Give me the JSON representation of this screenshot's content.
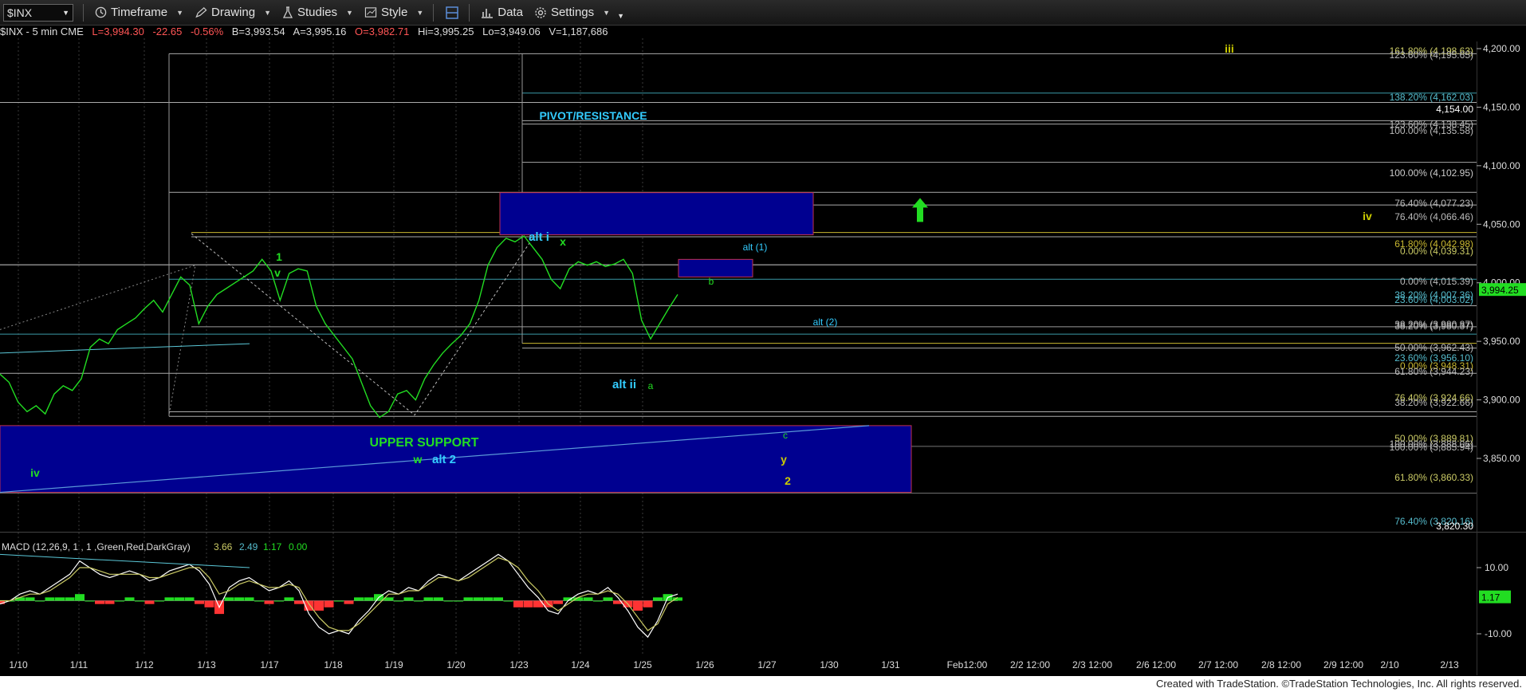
{
  "toolbar": {
    "symbol": "$INX",
    "items": [
      {
        "label": "Timeframe",
        "icon": "clock-icon"
      },
      {
        "label": "Drawing",
        "icon": "pencil-icon"
      },
      {
        "label": "Studies",
        "icon": "flask-icon"
      },
      {
        "label": "Style",
        "icon": "chart-style-icon"
      },
      {
        "label": "Data",
        "icon": "data-icon"
      },
      {
        "label": "Settings",
        "icon": "gear-icon"
      }
    ]
  },
  "info": {
    "symbol": "$INX - 5 min  CME",
    "last": "L=3,994.30",
    "change": "-22.65",
    "pct": "-0.56%",
    "bid": "B=3,993.54",
    "ask": "A=3,995.16",
    "open": "O=3,982.71",
    "high": "Hi=3,995.25",
    "low": "Lo=3,949.06",
    "volume": "V=1,187,686"
  },
  "colors": {
    "up": "#22dd22",
    "down": "#ff3333",
    "cyan": "#33ccff",
    "fib": "#cccc66",
    "box": "#000090"
  },
  "chart_data": [
    {
      "type": "line",
      "title": "$INX - 5 min",
      "x_ticks": [
        "1/10",
        "1/11",
        "1/12",
        "1/13",
        "1/17",
        "1/18",
        "1/19",
        "1/20",
        "1/23",
        "1/24",
        "1/25",
        "1/26",
        "1/27",
        "1/30",
        "1/31",
        "Feb12:00",
        "2/2 12:00",
        "2/3 12:00",
        "2/6 12:00",
        "2/7 12:00",
        "2/8 12:00",
        "2/9 12:00",
        "2/10",
        "2/13"
      ],
      "y_ticks": [
        "4,200.00",
        "4,150.00",
        "4,100.00",
        "4,050.00",
        "4,000.00",
        "3,950.00",
        "3,900.00",
        "3,850.00"
      ],
      "ylim": [
        3820,
        4225
      ],
      "last_price": "3,994.25",
      "series": [
        {
          "values": [
            3922,
            3915,
            3898,
            3890,
            3895,
            3888,
            3905,
            3912,
            3908,
            3918,
            3945,
            3952,
            3948,
            3960,
            3965,
            3970,
            3978,
            3985,
            3975,
            3990,
            4005,
            3998,
            3965,
            3980,
            3990,
            3995,
            4000,
            4005,
            4010,
            4020,
            4010,
            3985,
            4008,
            4012,
            4010,
            3980,
            3965,
            3955,
            3945,
            3935,
            3915,
            3895,
            3885,
            3890,
            3905,
            3908,
            3900,
            3918,
            3930,
            3940,
            3948,
            3955,
            3965,
            3985,
            4015,
            4030,
            4038,
            4035,
            4040,
            4030,
            4020,
            4003,
            3995,
            4012,
            4018,
            4015,
            4018,
            4014,
            4016,
            4020,
            4008,
            3968,
            3952,
            3965,
            3978,
            3990
          ]
        }
      ],
      "annotations": [
        {
          "text": "PIVOT/RESISTANCE"
        },
        {
          "text": "UPPER SUPPORT"
        },
        {
          "text": "iii"
        },
        {
          "text": "iv"
        },
        {
          "text": "iv"
        },
        {
          "text": "1"
        },
        {
          "text": "v"
        },
        {
          "text": "w"
        },
        {
          "text": "alt 2"
        },
        {
          "text": "alt i"
        },
        {
          "text": "x"
        },
        {
          "text": "alt ii"
        },
        {
          "text": "a"
        },
        {
          "text": "b"
        },
        {
          "text": "c"
        },
        {
          "text": "y"
        },
        {
          "text": "2"
        },
        {
          "text": "alt (1)"
        },
        {
          "text": "alt (2)"
        }
      ],
      "fib_labels": [
        {
          "text": "161.80% (4,198.63)"
        },
        {
          "text": "123.60% (4,195.65)"
        },
        {
          "text": "138.20% (4,162.03)"
        },
        {
          "text": "4,154.00"
        },
        {
          "text": "123.60% (4,138.45)"
        },
        {
          "text": "100.00% (4,135.58)"
        },
        {
          "text": "100.00% (4,102.95)"
        },
        {
          "text": "76.40% (4,077.23)"
        },
        {
          "text": "76.40% (4,066.46)"
        },
        {
          "text": "61.80% (4,042.98)"
        },
        {
          "text": "0.00% (4,039.31)"
        },
        {
          "text": "0.00% (4,015.39)"
        },
        {
          "text": "38.20% (4,007.36)"
        },
        {
          "text": "23.60% (4,003.02)"
        },
        {
          "text": "38.20% (3,980.87)"
        },
        {
          "text": "38.20% (3,980.37)"
        },
        {
          "text": "50.00% (3,962.43)"
        },
        {
          "text": "23.60% (3,956.10)"
        },
        {
          "text": "0.00% (3,948.31)"
        },
        {
          "text": "61.80% (3,944.23)"
        },
        {
          "text": "76.40% (3,924.66)"
        },
        {
          "text": "38.20% (3,922.66)"
        },
        {
          "text": "50.00% (3,889.81)"
        },
        {
          "text": "100.00% (3,888.06)"
        },
        {
          "text": "100.00% (3,885.94)"
        },
        {
          "text": "61.80% (3,860.33)"
        },
        {
          "text": "76.40% (3,820.16)"
        },
        {
          "text": "3,820.30"
        }
      ]
    },
    {
      "type": "line",
      "title": "MACD (12,26,9, 1 , 1 ,Green,Red,DarkGray)",
      "legend_values": [
        "3.66",
        "2.49",
        "1.17",
        "0.00"
      ],
      "y_ticks": [
        "10.00",
        "-10.00"
      ],
      "ylim": [
        -12,
        14
      ],
      "last_value": "1.17",
      "series": [
        {
          "name": "MACD",
          "values": [
            -1,
            0,
            2,
            3,
            2,
            4,
            6,
            8,
            12,
            10,
            8,
            7,
            8,
            9,
            8,
            6,
            7,
            9,
            10,
            11,
            9,
            5,
            -2,
            4,
            6,
            7,
            5,
            3,
            4,
            6,
            3,
            -4,
            -8,
            -10,
            -9,
            -10,
            -6,
            -3,
            1,
            3,
            2,
            4,
            3,
            6,
            8,
            7,
            6,
            8,
            10,
            12,
            14,
            12,
            8,
            4,
            1,
            -3,
            -4,
            0,
            2,
            3,
            2,
            4,
            1,
            -3,
            -8,
            -11,
            -6,
            1,
            2
          ]
        },
        {
          "name": "Signal",
          "values": [
            0,
            0,
            1,
            2,
            2,
            3,
            5,
            7,
            10,
            10,
            9,
            8,
            8,
            8,
            8,
            7,
            7,
            8,
            9,
            10,
            10,
            7,
            2,
            3,
            5,
            6,
            5,
            4,
            4,
            5,
            4,
            -1,
            -5,
            -8,
            -9,
            -9,
            -7,
            -4,
            -1,
            2,
            2,
            3,
            3,
            5,
            7,
            7,
            6,
            7,
            9,
            11,
            13,
            12,
            10,
            6,
            3,
            -1,
            -3,
            -1,
            1,
            2,
            2,
            3,
            2,
            -1,
            -5,
            -9,
            -7,
            -1,
            1
          ]
        },
        {
          "name": "Histogram",
          "values": [
            -1,
            0,
            1,
            1,
            0,
            1,
            1,
            1,
            2,
            0,
            -1,
            -1,
            0,
            1,
            0,
            -1,
            0,
            1,
            1,
            1,
            -1,
            -2,
            -4,
            1,
            1,
            1,
            0,
            -1,
            0,
            1,
            -1,
            -3,
            -3,
            -2,
            0,
            -1,
            1,
            1,
            2,
            1,
            0,
            1,
            0,
            1,
            1,
            0,
            0,
            1,
            1,
            1,
            1,
            0,
            -2,
            -2,
            -2,
            -2,
            -1,
            1,
            1,
            1,
            0,
            1,
            -1,
            -2,
            -3,
            -2,
            1,
            2,
            1
          ]
        }
      ]
    }
  ],
  "footer": {
    "text": "Created with TradeStation. ©TradeStation Technologies, Inc. All rights reserved."
  }
}
